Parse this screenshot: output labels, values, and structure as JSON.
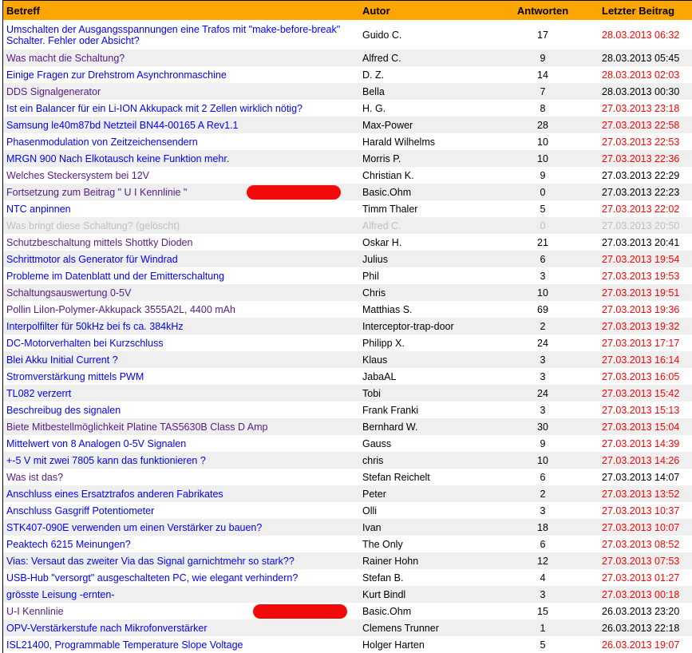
{
  "header": {
    "subject": "Betreff",
    "author": "Autor",
    "replies": "Antworten",
    "last_post": "Letzter Beitrag"
  },
  "colors": {
    "header_bg": "#FFA500",
    "link": "#0000FF",
    "visited": "#551A8B",
    "new_date": "#FF0000",
    "deleted": "#C0C0C0",
    "redaction": "#F20A0A"
  },
  "threads": [
    {
      "subject": "Umschalten der Ausgangsspannungen eine Trafos mit \"make-before-break\" Schalter. Fehler oder Absicht?",
      "author": "Guido C.",
      "replies": "17",
      "date": "28.03.2013 06:32",
      "new": true,
      "visited": false
    },
    {
      "subject": "Was macht die Schaltung?",
      "author": "Alfred C.",
      "replies": "9",
      "date": "28.03.2013 05:45",
      "new": false,
      "visited": true
    },
    {
      "subject": "Einige Fragen zur Drehstrom Asynchronmaschine",
      "author": "D. Z.",
      "replies": "14",
      "date": "28.03.2013 02:03",
      "new": true,
      "visited": false
    },
    {
      "subject": "DDS Signalgenerator",
      "author": "Bella",
      "replies": "7",
      "date": "28.03.2013 00:30",
      "new": false,
      "visited": true
    },
    {
      "subject": "Ist ein Balancer für ein Li-ION Akkupack mit 2 Zellen wirklich nötig?",
      "author": "H. G.",
      "replies": "8",
      "date": "27.03.2013 23:18",
      "new": true,
      "visited": false
    },
    {
      "subject": "Samsung le40m87bd Netzteil BN44-00165 A Rev1.1",
      "author": "Max-Power",
      "replies": "28",
      "date": "27.03.2013 22:58",
      "new": true,
      "visited": false
    },
    {
      "subject": "Phasenmodulation von Zeitzeichensendern",
      "author": "Harald Wilhelms",
      "replies": "10",
      "date": "27.03.2013 22:53",
      "new": true,
      "visited": false
    },
    {
      "subject": "MRGN 900 Nach Elkotausch keine Funktion mehr.",
      "author": "Morris P.",
      "replies": "10",
      "date": "27.03.2013 22:36",
      "new": true,
      "visited": false
    },
    {
      "subject": "Welches Steckersystem bei 12V",
      "author": "Christian K.",
      "replies": "9",
      "date": "27.03.2013 22:29",
      "new": false,
      "visited": true
    },
    {
      "subject": "Fortsetzung zum Beitrag \" U I Kennlinie \"",
      "author": "Basic.Ohm",
      "replies": "0",
      "date": "27.03.2013 22:23",
      "new": false,
      "visited": true,
      "redacted": true
    },
    {
      "subject": "NTC anpinnen",
      "author": "Timm Thaler",
      "replies": "5",
      "date": "27.03.2013 22:02",
      "new": true,
      "visited": false
    },
    {
      "subject": "Was bringt diese Schaltung? (gelöscht)",
      "author": "Alfred C.",
      "replies": "0",
      "date": "27.03.2013 20:50",
      "new": false,
      "visited": false,
      "deleted": true
    },
    {
      "subject": "Schutzbeschaltung mittels Shottky Dioden",
      "author": "Oskar H.",
      "replies": "21",
      "date": "27.03.2013 20:41",
      "new": false,
      "visited": true
    },
    {
      "subject": "Schrittmotor als Generator für Windrad",
      "author": "Julius",
      "replies": "6",
      "date": "27.03.2013 19:54",
      "new": true,
      "visited": false
    },
    {
      "subject": "Probleme im Datenblatt und der Emitterschaltung",
      "author": "Phil",
      "replies": "3",
      "date": "27.03.2013 19:53",
      "new": true,
      "visited": false
    },
    {
      "subject": "Schaltungsauswertung 0-5V",
      "author": "Chris",
      "replies": "10",
      "date": "27.03.2013 19:51",
      "new": true,
      "visited": true
    },
    {
      "subject": "Pollin LiIon-Polymer-Akkupack 3555A2L, 4400 mAh",
      "author": "Matthias S.",
      "replies": "69",
      "date": "27.03.2013 19:36",
      "new": true,
      "visited": true
    },
    {
      "subject": "Interpolfilter für 50kHz bei fs ca. 384kHz",
      "author": "Interceptor-trap-door",
      "replies": "2",
      "date": "27.03.2013 19:32",
      "new": true,
      "visited": false
    },
    {
      "subject": "DC-Motorverhalten bei Kurzschluss",
      "author": "Philipp X.",
      "replies": "24",
      "date": "27.03.2013 17:17",
      "new": true,
      "visited": false
    },
    {
      "subject": "Blei Akku Initial Current ?",
      "author": "Klaus",
      "replies": "3",
      "date": "27.03.2013 16:14",
      "new": true,
      "visited": false
    },
    {
      "subject": "Stromverstärkung mittels PWM",
      "author": "JabaAL",
      "replies": "3",
      "date": "27.03.2013 16:05",
      "new": true,
      "visited": false
    },
    {
      "subject": "TL082 verzerrt",
      "author": "Tobi",
      "replies": "24",
      "date": "27.03.2013 15:42",
      "new": true,
      "visited": false
    },
    {
      "subject": "Beschreibug des signalen",
      "author": "Frank Franki",
      "replies": "3",
      "date": "27.03.2013 15:13",
      "new": true,
      "visited": false
    },
    {
      "subject": "Biete Mitbestellmöglichkeit Platine TAS5630B Class D Amp",
      "author": "Bernhard W.",
      "replies": "30",
      "date": "27.03.2013 15:04",
      "new": true,
      "visited": true
    },
    {
      "subject": "Mittelwert von 8 Analogen 0-5V Signalen",
      "author": "Gauss",
      "replies": "9",
      "date": "27.03.2013 14:39",
      "new": true,
      "visited": false
    },
    {
      "subject": "+-5 V mit zwei 7805 kann das funktionieren ?",
      "author": "chris",
      "replies": "10",
      "date": "27.03.2013 14:26",
      "new": true,
      "visited": false
    },
    {
      "subject": "Was ist das?",
      "author": "Stefan Reichelt",
      "replies": "6",
      "date": "27.03.2013 14:07",
      "new": false,
      "visited": true
    },
    {
      "subject": "Anschluss eines Ersatztrafos anderen Fabrikates",
      "author": "Peter",
      "replies": "2",
      "date": "27.03.2013 13:52",
      "new": true,
      "visited": false
    },
    {
      "subject": "Anschluss Gasgriff Potentiometer",
      "author": "Olli",
      "replies": "3",
      "date": "27.03.2013 10:37",
      "new": true,
      "visited": false
    },
    {
      "subject": "STK407-090E verwenden um einen Verstärker zu bauen?",
      "author": "Ivan",
      "replies": "18",
      "date": "27.03.2013 10:07",
      "new": true,
      "visited": false
    },
    {
      "subject": "Peaktech 6215 Meinungen?",
      "author": "The Only",
      "replies": "6",
      "date": "27.03.2013 08:52",
      "new": true,
      "visited": false
    },
    {
      "subject": "Vias: Versaut das zweiter Via das Signal garnichtmehr so stark??",
      "author": "Rainer Hohn",
      "replies": "12",
      "date": "27.03.2013 07:53",
      "new": true,
      "visited": false
    },
    {
      "subject": "USB-Hub \"versorgt\" ausgeschalteten PC, wie elegant verhindern?",
      "author": "Stefan B.",
      "replies": "4",
      "date": "27.03.2013 01:27",
      "new": true,
      "visited": false
    },
    {
      "subject": "grösste Leisung -ernten-",
      "author": "Kurt Bindl",
      "replies": "3",
      "date": "27.03.2013 00:18",
      "new": true,
      "visited": false
    },
    {
      "subject": "U-I Kennlinie",
      "author": "Basic.Ohm",
      "replies": "15",
      "date": "26.03.2013 23:20",
      "new": false,
      "visited": true,
      "redacted": true
    },
    {
      "subject": "OPV-Verstärkerstufe nach Mikrofonverstärker",
      "author": "Clemens Trunner",
      "replies": "1",
      "date": "26.03.2013 22:18",
      "new": false,
      "visited": false
    },
    {
      "subject": "ISL21400, Programmable Temperature Slope Voltage",
      "author": "Holger Harten",
      "replies": "5",
      "date": "26.03.2013 19:07",
      "new": true,
      "visited": false
    }
  ]
}
